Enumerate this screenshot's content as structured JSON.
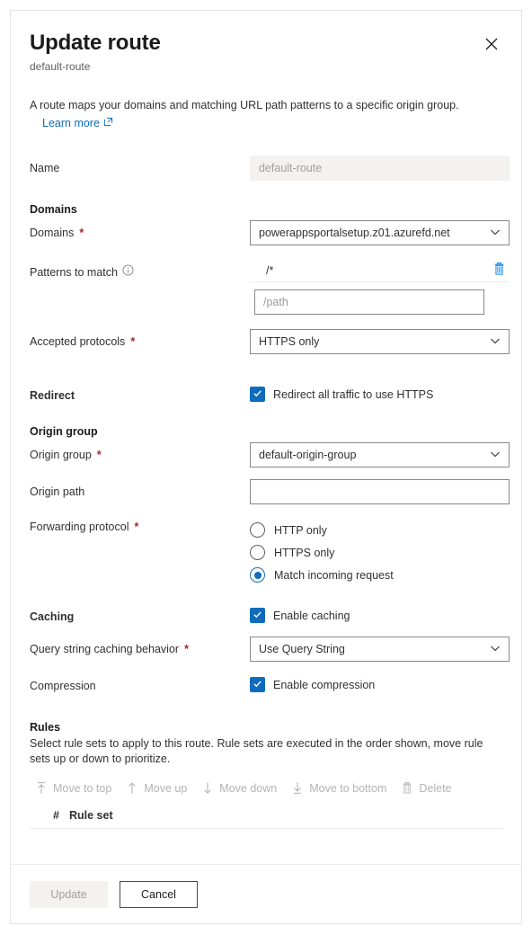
{
  "panel": {
    "title": "Update route",
    "subtitle": "default-route",
    "close_icon": "close-icon",
    "description": "A route maps your domains and matching URL path patterns to a specific origin group.",
    "learn_more": "Learn more",
    "external_link_icon": "external-link-icon"
  },
  "name_field": {
    "label": "Name",
    "value": "default-route"
  },
  "domains_section": {
    "heading": "Domains",
    "domains": {
      "label": "Domains",
      "required": "*",
      "value": "powerappsportalsetup.z01.azurefd.net",
      "chevron_icon": "chevron-down-icon"
    },
    "patterns": {
      "label": "Patterns to match",
      "info_icon": "info-icon",
      "value": "/*",
      "delete_icon": "trash-icon",
      "input_placeholder": "/path",
      "input_value": ""
    },
    "accepted_protocols": {
      "label": "Accepted protocols",
      "required": "*",
      "value": "HTTPS only",
      "chevron_icon": "chevron-down-icon"
    }
  },
  "redirect_section": {
    "label": "Redirect",
    "checkbox_label": "Redirect all traffic to use HTTPS",
    "checked": true,
    "check_icon": "checkmark-icon"
  },
  "origin_section": {
    "heading": "Origin group",
    "origin_group": {
      "label": "Origin group",
      "required": "*",
      "value": "default-origin-group",
      "chevron_icon": "chevron-down-icon"
    },
    "origin_path": {
      "label": "Origin path",
      "value": "",
      "placeholder": ""
    },
    "forwarding_protocol": {
      "label": "Forwarding protocol",
      "required": "*",
      "options": [
        {
          "label": "HTTP only",
          "selected": false
        },
        {
          "label": "HTTPS only",
          "selected": false
        },
        {
          "label": "Match incoming request",
          "selected": true
        }
      ]
    }
  },
  "caching_section": {
    "label": "Caching",
    "enable_caching_label": "Enable caching",
    "enable_caching_checked": true,
    "query_string": {
      "label": "Query string caching behavior",
      "required": "*",
      "value": "Use Query String",
      "chevron_icon": "chevron-down-icon"
    },
    "compression": {
      "label": "Compression",
      "checkbox_label": "Enable compression",
      "checked": true
    }
  },
  "rules_section": {
    "heading": "Rules",
    "description": "Select rule sets to apply to this route. Rule sets are executed in the order shown, move rule sets up or down to prioritize.",
    "commands": [
      {
        "label": "Move to top",
        "icon": "arrow-up-to-line-icon",
        "disabled": true
      },
      {
        "label": "Move up",
        "icon": "arrow-up-icon",
        "disabled": true
      },
      {
        "label": "Move down",
        "icon": "arrow-down-icon",
        "disabled": true
      },
      {
        "label": "Move to bottom",
        "icon": "arrow-down-to-line-icon",
        "disabled": true
      },
      {
        "label": "Delete",
        "icon": "trash-icon",
        "disabled": true
      }
    ],
    "table_headers": {
      "number": "#",
      "rule_set": "Rule set"
    },
    "rows": []
  },
  "footer": {
    "update_label": "Update",
    "update_disabled": true,
    "cancel_label": "Cancel"
  },
  "colors": {
    "accent": "#0f6cbd",
    "required_asterisk": "#a4262c",
    "disabled_text": "#a19f9d",
    "border": "#8a8886"
  }
}
